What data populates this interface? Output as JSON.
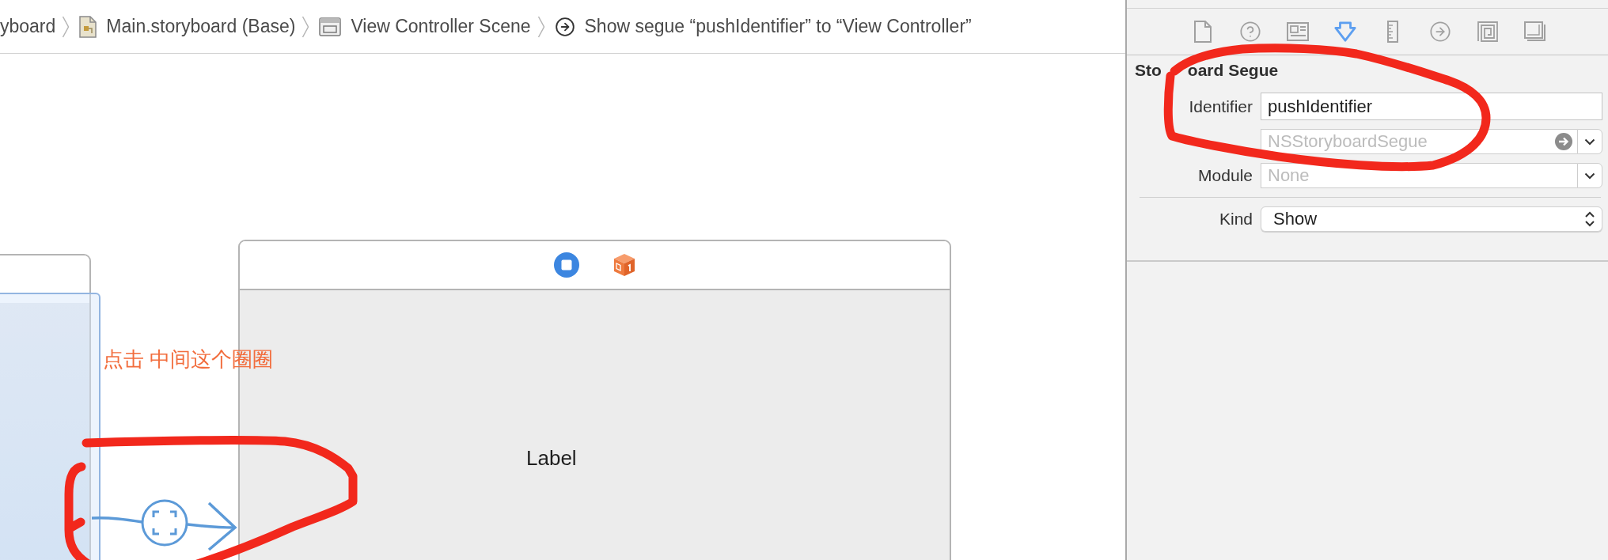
{
  "breadcrumbs": [
    {
      "kind": "plain",
      "label": "yboard"
    },
    {
      "kind": "storyboard",
      "label": "Main.storyboard (Base)"
    },
    {
      "kind": "scene",
      "label": "View Controller Scene"
    },
    {
      "kind": "segue",
      "label": "Show segue “pushIdentifier” to “View Controller”"
    }
  ],
  "inspector": {
    "tabs": [
      {
        "kind": "file",
        "selected": false
      },
      {
        "kind": "help",
        "selected": false
      },
      {
        "kind": "identity",
        "selected": false
      },
      {
        "kind": "attributes",
        "selected": true
      },
      {
        "kind": "size",
        "selected": false
      },
      {
        "kind": "connections",
        "selected": false
      },
      {
        "kind": "bindings",
        "selected": false
      },
      {
        "kind": "effects",
        "selected": false
      }
    ],
    "section_title_parts": [
      "Sto",
      "oard Segue"
    ],
    "fields": [
      {
        "kind": "text",
        "label": "Identifier",
        "value": "pushIdentifier"
      },
      {
        "kind": "classcombo",
        "placeholder": "NSStoryboardSegue"
      },
      {
        "kind": "combo",
        "label": "Module",
        "placeholder": "None"
      },
      {
        "kind": "popup",
        "label": "Kind",
        "value": "Show"
      }
    ]
  },
  "canvas": {
    "annotation": "点击 中间这个圈圈",
    "scenes": [
      {
        "kind": "window",
        "highlighted": true
      },
      {
        "kind": "viewcontroller",
        "highlighted": false,
        "label": "Label"
      }
    ]
  }
}
